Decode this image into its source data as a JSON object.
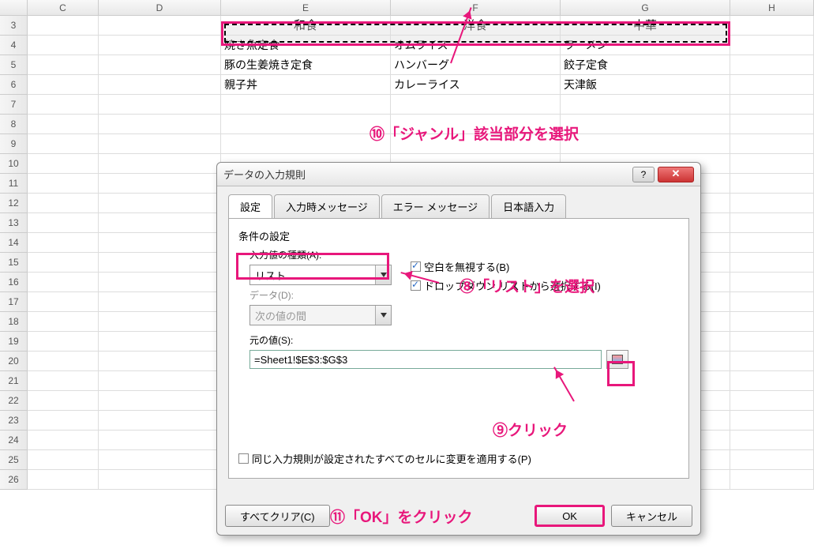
{
  "columns": [
    "C",
    "D",
    "E",
    "F",
    "G",
    "H"
  ],
  "rows": [
    "3",
    "4",
    "5",
    "6",
    "7",
    "8",
    "9",
    "10",
    "11",
    "12",
    "13",
    "14",
    "15",
    "16",
    "17",
    "18",
    "19",
    "20",
    "21",
    "22",
    "23",
    "24",
    "25",
    "26"
  ],
  "cells": {
    "r3": {
      "E": "和食",
      "F": "洋食",
      "G": "中華"
    },
    "r4": {
      "E": "焼き魚定食",
      "F": "オムライス",
      "G": "ラーメン"
    },
    "r5": {
      "E": "豚の生姜焼き定食",
      "F": "ハンバーグ",
      "G": "餃子定食"
    },
    "r6": {
      "E": "親子丼",
      "F": "カレーライス",
      "G": "天津飯"
    }
  },
  "annotations": {
    "a8": "⑧「リスト」を選択",
    "a9": "⑨クリック",
    "a10": "⑩「ジャンル」該当部分を選択",
    "a11": "⑪「OK」をクリック"
  },
  "dialog": {
    "title": "データの入力規則",
    "tabs": {
      "t1": "設定",
      "t2": "入力時メッセージ",
      "t3": "エラー メッセージ",
      "t4": "日本語入力"
    },
    "section": "条件の設定",
    "type_label": "入力値の種類(A):",
    "type_value": "リスト",
    "data_label": "データ(D):",
    "data_value": "次の値の間",
    "cb_blank": "空白を無視する(B)",
    "cb_dropdown": "ドロップダウン リストから選択する(I)",
    "source_label": "元の値(S):",
    "source_value": "=Sheet1!$E$3:$G$3",
    "cb_applyall": "同じ入力規則が設定されたすべてのセルに変更を適用する(P)",
    "clear_btn": "すべてクリア(C)",
    "ok_btn": "OK",
    "cancel_btn": "キャンセル"
  }
}
